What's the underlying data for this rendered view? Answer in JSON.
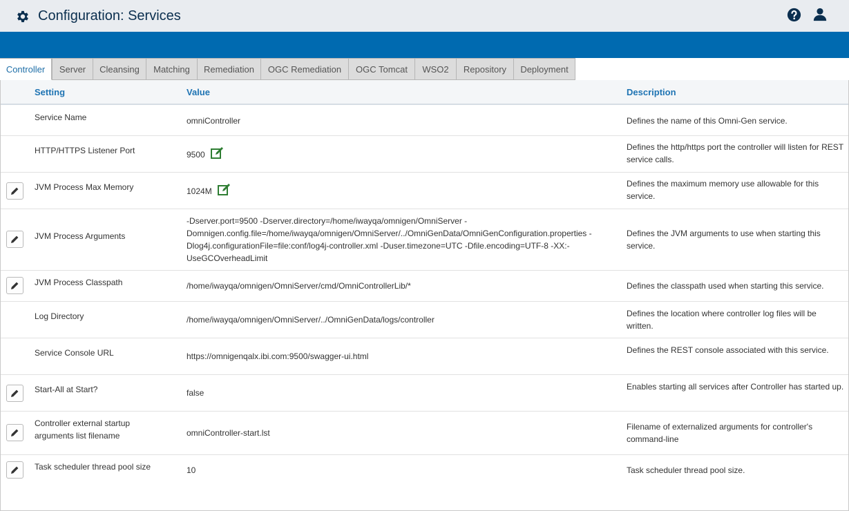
{
  "header": {
    "title": "Configuration: Services",
    "icons": [
      "gear-icon",
      "help-icon",
      "user-icon"
    ]
  },
  "tabs": [
    {
      "label": "Controller",
      "active": true
    },
    {
      "label": "Server",
      "active": false
    },
    {
      "label": "Cleansing",
      "active": false
    },
    {
      "label": "Matching",
      "active": false
    },
    {
      "label": "Remediation",
      "active": false
    },
    {
      "label": "OGC Remediation",
      "active": false
    },
    {
      "label": "OGC Tomcat",
      "active": false
    },
    {
      "label": "WSO2",
      "active": false
    },
    {
      "label": "Repository",
      "active": false
    },
    {
      "label": "Deployment",
      "active": false
    }
  ],
  "table": {
    "headers": {
      "setting": "Setting",
      "value": "Value",
      "description": "Description"
    },
    "rows": [
      {
        "setting": "Service Name",
        "value": "omniController",
        "description": "Defines the name of this Omni-Gen service.",
        "editable": false,
        "inline_edit": false
      },
      {
        "setting": "HTTP/HTTPS Listener Port",
        "value": "9500",
        "description": "Defines the http/https port the controller will listen for REST service calls.",
        "editable": false,
        "inline_edit": true
      },
      {
        "setting": "JVM Process Max Memory",
        "value": "1024M",
        "description": "Defines the maximum memory use allowable for this service.",
        "editable": true,
        "inline_edit": true
      },
      {
        "setting": "JVM Process Arguments",
        "value": "-Dserver.port=9500 -Dserver.directory=/home/iwayqa/omnigen/OmniServer -Domnigen.config.file=/home/iwayqa/omnigen/OmniServer/../OmniGenData/OmniGenConfiguration.properties -Dlog4j.configurationFile=file:conf/log4j-controller.xml -Duser.timezone=UTC -Dfile.encoding=UTF-8 -XX:-UseGCOverheadLimit",
        "description": "Defines the JVM arguments to use when starting this service.",
        "editable": true,
        "inline_edit": false
      },
      {
        "setting": "JVM Process Classpath",
        "value": "/home/iwayqa/omnigen/OmniServer/cmd/OmniControllerLib/*",
        "description": "Defines the classpath used when starting this service.",
        "editable": true,
        "inline_edit": false
      },
      {
        "setting": "Log Directory",
        "value": "/home/iwayqa/omnigen/OmniServer/../OmniGenData/logs/controller",
        "description": "Defines the location where controller log files will be written.",
        "editable": false,
        "inline_edit": false
      },
      {
        "setting": "Service Console URL",
        "value": "https://omnigenqalx.ibi.com:9500/swagger-ui.html",
        "description": "Defines the REST console associated with this service.",
        "editable": false,
        "inline_edit": false
      },
      {
        "setting": "Start-All at Start?",
        "value": "false",
        "description": "Enables starting all services after Controller has started up.",
        "editable": true,
        "inline_edit": false
      },
      {
        "setting": "Controller external startup arguments list filename",
        "value": "omniController-start.lst",
        "description": "Filename of externalized arguments for controller's command-line",
        "editable": true,
        "inline_edit": false
      },
      {
        "setting": "Task scheduler thread pool size",
        "value": "10",
        "description": "Task scheduler thread pool size.",
        "editable": true,
        "inline_edit": false
      }
    ]
  },
  "colors": {
    "header_bg": "#e9ecf0",
    "title_text": "#0b2f4f",
    "brand_bar": "#006ab0",
    "column_header_text": "#1f74b3",
    "inline_edit_icon": "#2e7d32"
  }
}
